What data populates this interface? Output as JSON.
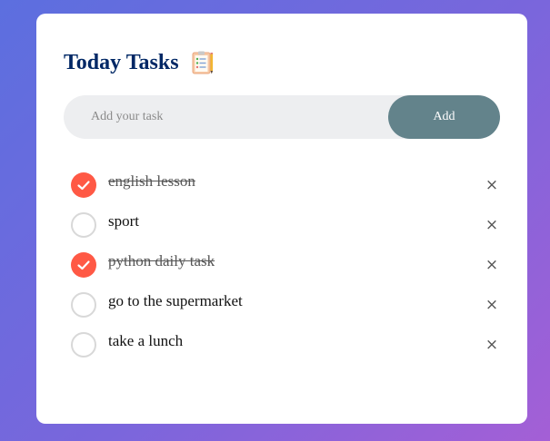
{
  "app": {
    "title": "Today Tasks",
    "title_icon": "clipboard-checklist-icon"
  },
  "input": {
    "placeholder": "Add your task",
    "value": "",
    "add_label": "Add"
  },
  "tasks": [
    {
      "text": "english lesson",
      "done": true
    },
    {
      "text": "sport",
      "done": false
    },
    {
      "text": "python daily task",
      "done": true
    },
    {
      "text": "go to the supermarket",
      "done": false
    },
    {
      "text": "take a lunch",
      "done": false
    }
  ],
  "remove_symbol": "×",
  "colors": {
    "title": "#002765",
    "checked": "#ff5945",
    "add_button": "#63838b",
    "input_bg": "#edeef0"
  }
}
